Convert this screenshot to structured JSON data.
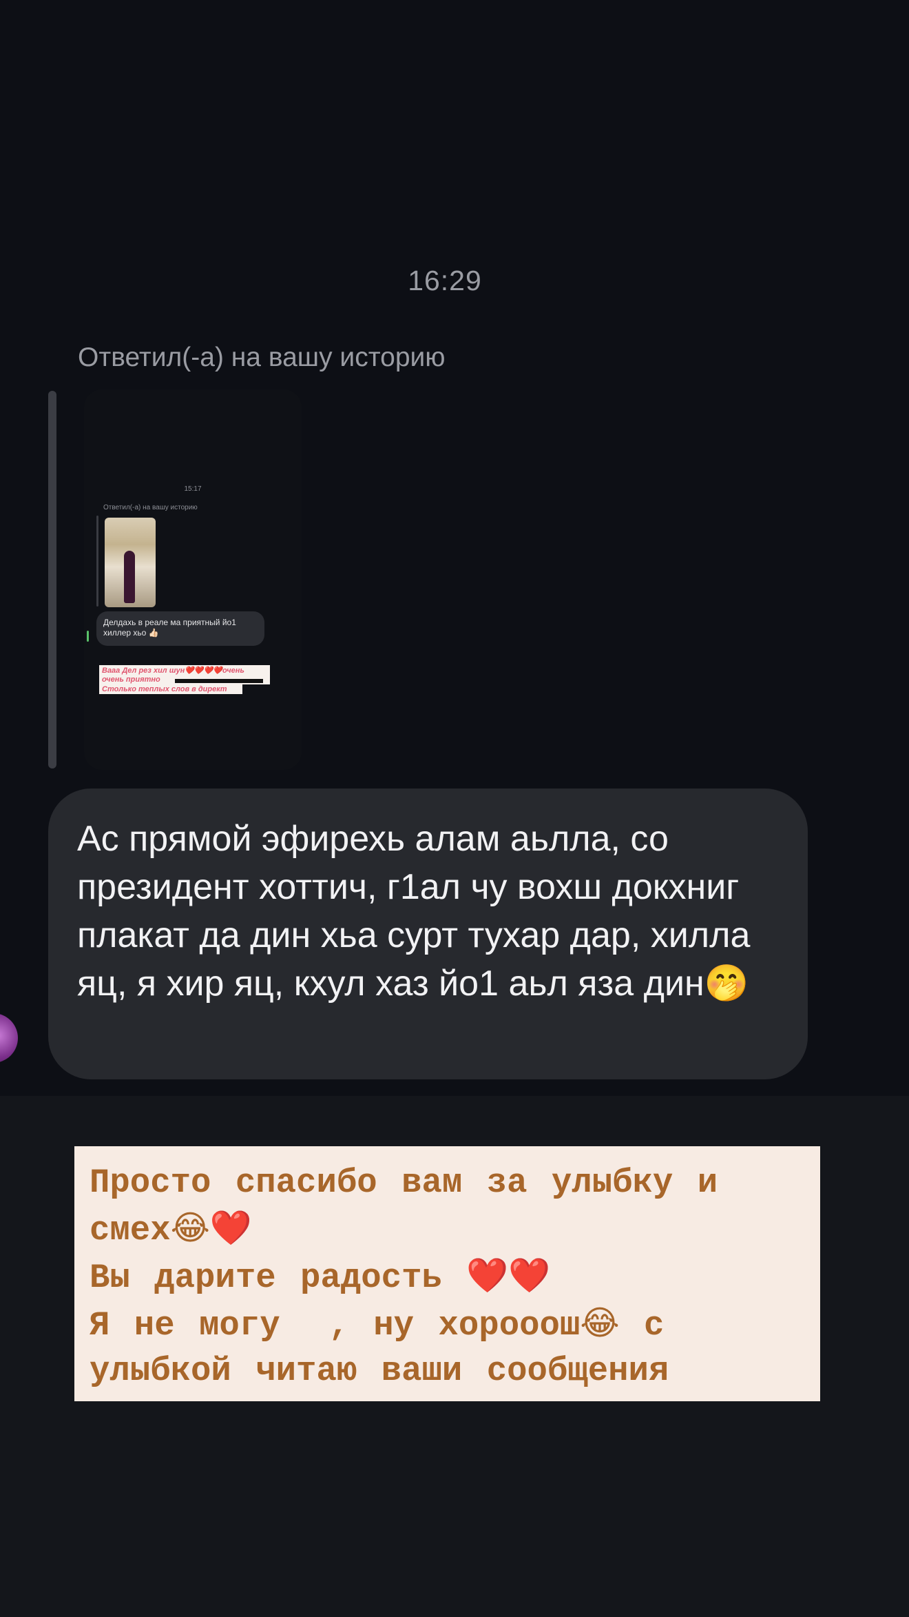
{
  "chat": {
    "timestamp": "16:29",
    "reply_label": "Ответил(-а) на вашу историю",
    "story_preview": {
      "time": "15:17",
      "label": "Ответил(-а) на вашу историю",
      "bubble_text": "Делдахь в реале ма приятный йо1 хиллер хьо 👍🏻",
      "sticker_lines": [
        "Вааа Дел рез хил шун❤️❤️❤️❤️очень",
        "очень приятно",
        "Столько теплых слов в директ"
      ]
    },
    "message": {
      "text": "Ас прямой эфирехь алам аьлла, со президент хоттич, г1ал чу вохш докхниг плакат да дин хьа сурт тухар дар, хилла яц, я хир яц, кхул хаз йо1 аьл яза дин🤭"
    }
  },
  "text_sticker": {
    "line1": "Просто спасибо вам за улыбку и",
    "line2_text": "смех",
    "line2_emoji": "😂❤️",
    "line3_text": "Вы дарите радость ",
    "line3_emoji": "❤️❤️",
    "line4_text": "Я не могу  , ну хорооош",
    "line4_emoji": "😂",
    "line4_tail": " с",
    "line5": "улыбкой читаю ваши сообщения"
  },
  "colors": {
    "background": "#14161b",
    "chat_background": "#0d0f15",
    "bubble": "#27292e",
    "sticker_background": "#f7ebe3",
    "sticker_text": "#a8662a"
  }
}
